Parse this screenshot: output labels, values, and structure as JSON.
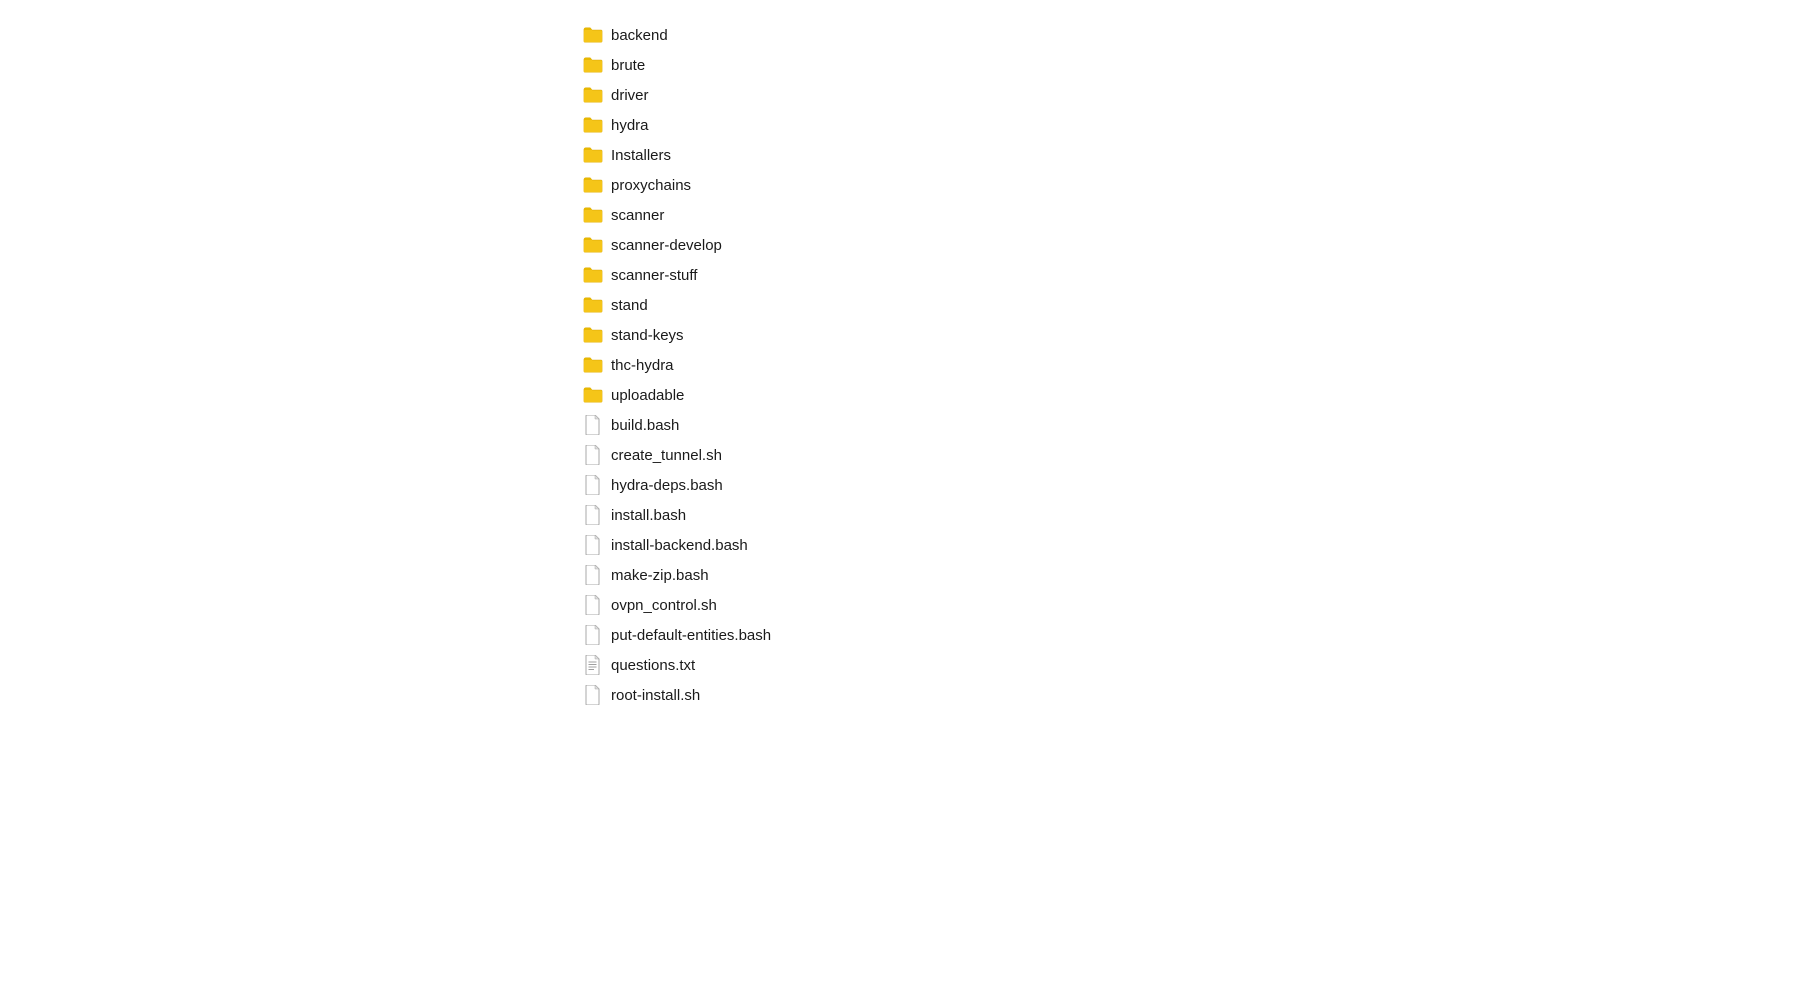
{
  "items": [
    {
      "id": "backend",
      "label": "backend",
      "type": "folder"
    },
    {
      "id": "brute",
      "label": "brute",
      "type": "folder"
    },
    {
      "id": "driver",
      "label": "driver",
      "type": "folder"
    },
    {
      "id": "hydra",
      "label": "hydra",
      "type": "folder"
    },
    {
      "id": "Installers",
      "label": "Installers",
      "type": "folder"
    },
    {
      "id": "proxychains",
      "label": "proxychains",
      "type": "folder"
    },
    {
      "id": "scanner",
      "label": "scanner",
      "type": "folder"
    },
    {
      "id": "scanner-develop",
      "label": "scanner-develop",
      "type": "folder"
    },
    {
      "id": "scanner-stuff",
      "label": "scanner-stuff",
      "type": "folder"
    },
    {
      "id": "stand",
      "label": "stand",
      "type": "folder"
    },
    {
      "id": "stand-keys",
      "label": "stand-keys",
      "type": "folder"
    },
    {
      "id": "thc-hydra",
      "label": "thc-hydra",
      "type": "folder"
    },
    {
      "id": "uploadable",
      "label": "uploadable",
      "type": "folder"
    },
    {
      "id": "build.bash",
      "label": "build.bash",
      "type": "file"
    },
    {
      "id": "create_tunnel.sh",
      "label": "create_tunnel.sh",
      "type": "file"
    },
    {
      "id": "hydra-deps.bash",
      "label": "hydra-deps.bash",
      "type": "file"
    },
    {
      "id": "install.bash",
      "label": "install.bash",
      "type": "file"
    },
    {
      "id": "install-backend.bash",
      "label": "install-backend.bash",
      "type": "file"
    },
    {
      "id": "make-zip.bash",
      "label": "make-zip.bash",
      "type": "file"
    },
    {
      "id": "ovpn_control.sh",
      "label": "ovpn_control.sh",
      "type": "file"
    },
    {
      "id": "put-default-entities.bash",
      "label": "put-default-entities.bash",
      "type": "file"
    },
    {
      "id": "questions.txt",
      "label": "questions.txt",
      "type": "file-text"
    },
    {
      "id": "root-install.sh",
      "label": "root-install.sh",
      "type": "file"
    }
  ],
  "colors": {
    "folder": "#F5C518",
    "folder_shadow": "#E6A800"
  }
}
